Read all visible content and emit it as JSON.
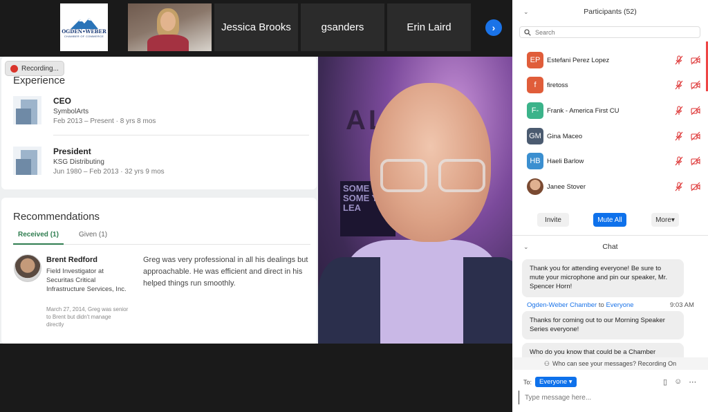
{
  "gallery": {
    "logo": {
      "line1": "OGDEN•WEBER",
      "line2": "CHAMBER OF COMMERCE"
    },
    "tiles": [
      "Jessica Brooks",
      "gsanders",
      "Erin Laird"
    ],
    "next_icon": "chevron-right-icon"
  },
  "recording": {
    "label": "Recording..."
  },
  "profile": {
    "experience_title": "Experience",
    "experience": [
      {
        "role": "CEO",
        "company": "SymbolArts",
        "dates": "Feb 2013 – Present · 8 yrs 8 mos"
      },
      {
        "role": "President",
        "company": "KSG Distributing",
        "dates": "Jun 1980 – Feb 2013 · 32 yrs 9 mos"
      }
    ],
    "recommendations_title": "Recommendations",
    "tabs": [
      "Received (1)",
      "Given (1)"
    ],
    "recommendation": {
      "name": "Brent Redford",
      "title": "Field Investigator at Securitas Critical Infrastructure Services, Inc.",
      "meta": "March 27, 2014, Greg was senior to Brent but didn't manage directly",
      "text_lines": [
        "Greg was very professional in all his dealings but",
        "approachable. He was efficient and direct in his",
        "helped things run smoothly."
      ]
    }
  },
  "speaker_video": {
    "wall_text": "ALT",
    "poster": "SOME YOU SOME YOU LEA"
  },
  "participants": {
    "header": "Participants (52)",
    "search_placeholder": "Search",
    "list": [
      {
        "initials": "EP",
        "name": "Estefani Perez Lopez",
        "color": "#e05d3a"
      },
      {
        "initials": "f",
        "name": "firetoss",
        "color": "#e05d3a"
      },
      {
        "initials": "F-",
        "name": "Frank - America First CU",
        "color": "#3bb38a"
      },
      {
        "initials": "GM",
        "name": "Gina Maceo",
        "color": "#4b5b70"
      },
      {
        "initials": "HB",
        "name": "Haeli Barlow",
        "color": "#3b8fd0"
      },
      {
        "initials": "",
        "name": "Janee Stover",
        "color": "#b07a5a"
      }
    ],
    "buttons": {
      "invite": "Invite",
      "mute_all": "Mute All",
      "more": "More▾"
    }
  },
  "chat": {
    "header": "Chat",
    "messages": [
      {
        "text": "Thank you for attending everyone! Be sure to mute your microphone and pin our speaker, Mr. Spencer Horn!"
      },
      {
        "text": "Thanks for coming out to our Morning Speaker Series everyone!"
      },
      {
        "text": "Who do you know that could be a Chamber"
      }
    ],
    "sender_from": "Ogden-Weber Chamber",
    "sender_to_word": "to",
    "sender_to": "Everyone",
    "time": "9:03 AM",
    "visibility": "Who can see your messages? Recording On",
    "to_label": "To:",
    "to_value": "Everyone ▾",
    "input_placeholder": "Type message here..."
  }
}
